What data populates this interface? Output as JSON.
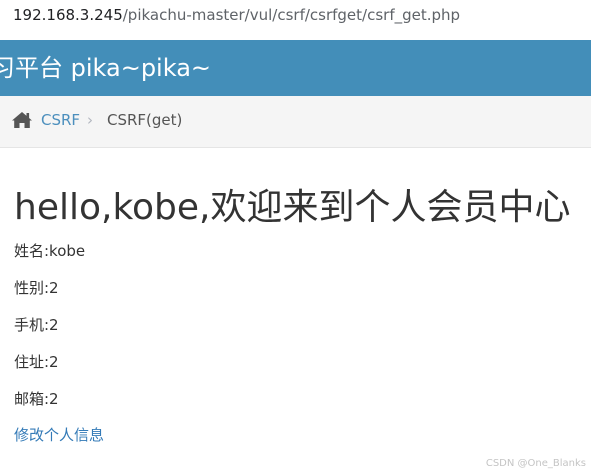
{
  "browser": {
    "url_host": "192.168.3.245",
    "url_path": "/pikachu-master/vul/csrf/csrfget/csrf_get.php"
  },
  "header": {
    "title": "习平台 pika~pika~"
  },
  "breadcrumb": {
    "home_icon": "home-icon",
    "link": "CSRF",
    "separator": "›",
    "current": "CSRF(get)"
  },
  "main": {
    "heading": "hello,kobe,欢迎来到个人会员中心",
    "fields": [
      "姓名:kobe",
      "性别:2",
      "手机:2",
      "住址:2",
      "邮箱:2"
    ],
    "edit_link": "修改个人信息"
  },
  "watermark": "CSDN @One_Blanks",
  "colors": {
    "header_bg": "#438eb9",
    "link": "#337ab7",
    "breadcrumb_bg": "#f5f5f5"
  }
}
